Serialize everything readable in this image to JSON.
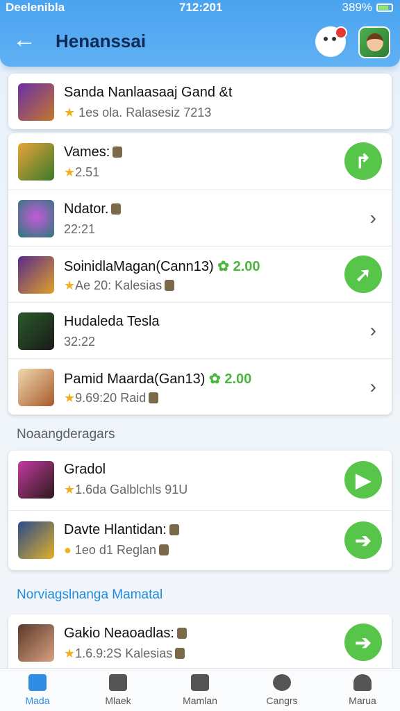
{
  "status_bar": {
    "carrier": "Deelenibla",
    "time": "712:201",
    "battery": "389%"
  },
  "header": {
    "back_icon": "arrow-left-icon",
    "title": "Henanssai"
  },
  "top_card": {
    "title": "Sanda Nanlaasaaj Gand &t",
    "subtitle": "1es ola. Ralasesiz 7213"
  },
  "list_one": [
    {
      "title": "Vames:",
      "subtitle": "2.51",
      "action": "button",
      "icon": "arrow-icon"
    },
    {
      "title": "Ndator.",
      "subtitle": "22:21",
      "action": "chevron",
      "icon": "chevron-right-icon"
    },
    {
      "title": "SoinidlaMagan(Cann13)",
      "title_tag": "2.00",
      "subtitle": "Ae 20: Kalesias",
      "action": "button",
      "icon": "arrow-icon"
    },
    {
      "title": "Hudaleda Tesla",
      "subtitle": "32:22",
      "action": "chevron",
      "icon": "chevron-right-icon"
    },
    {
      "title": "Pamid Maarda(Gan13)",
      "title_tag": "2.00",
      "subtitle": "9.69:20 Raid",
      "action": "chevron",
      "icon": "chevron-right-icon"
    }
  ],
  "section_one_label": "Noaangderagars",
  "list_two": [
    {
      "title": "Gradol",
      "subtitle": "1.6da Galblchls 91U",
      "action": "button",
      "icon": "play-icon"
    },
    {
      "title": "Davte Hlantidan:",
      "subtitle": "1eo d1 Reglan",
      "action": "button",
      "icon": "arrow-icon"
    }
  ],
  "section_two_label": "Norviagslnanga Mamatal",
  "list_three": [
    {
      "title": "Gakio Neaoadlas:",
      "subtitle": "1.6.9:2S Kalesias",
      "action": "button",
      "icon": "arrow-right-icon"
    }
  ],
  "bottom_nav": [
    {
      "label": "Mada",
      "icon": "home-icon",
      "active": true
    },
    {
      "label": "Mlaek",
      "icon": "box-icon",
      "active": false
    },
    {
      "label": "Mamlan",
      "icon": "apps-icon",
      "active": false
    },
    {
      "label": "Cangrs",
      "icon": "chat-icon",
      "active": false
    },
    {
      "label": "Marua",
      "icon": "profile-icon",
      "active": false
    }
  ],
  "colors": {
    "header": "#4aa3f0",
    "accent_green": "#57c44a",
    "nav_active": "#2f8de4",
    "section_blue": "#1d8ce0"
  }
}
